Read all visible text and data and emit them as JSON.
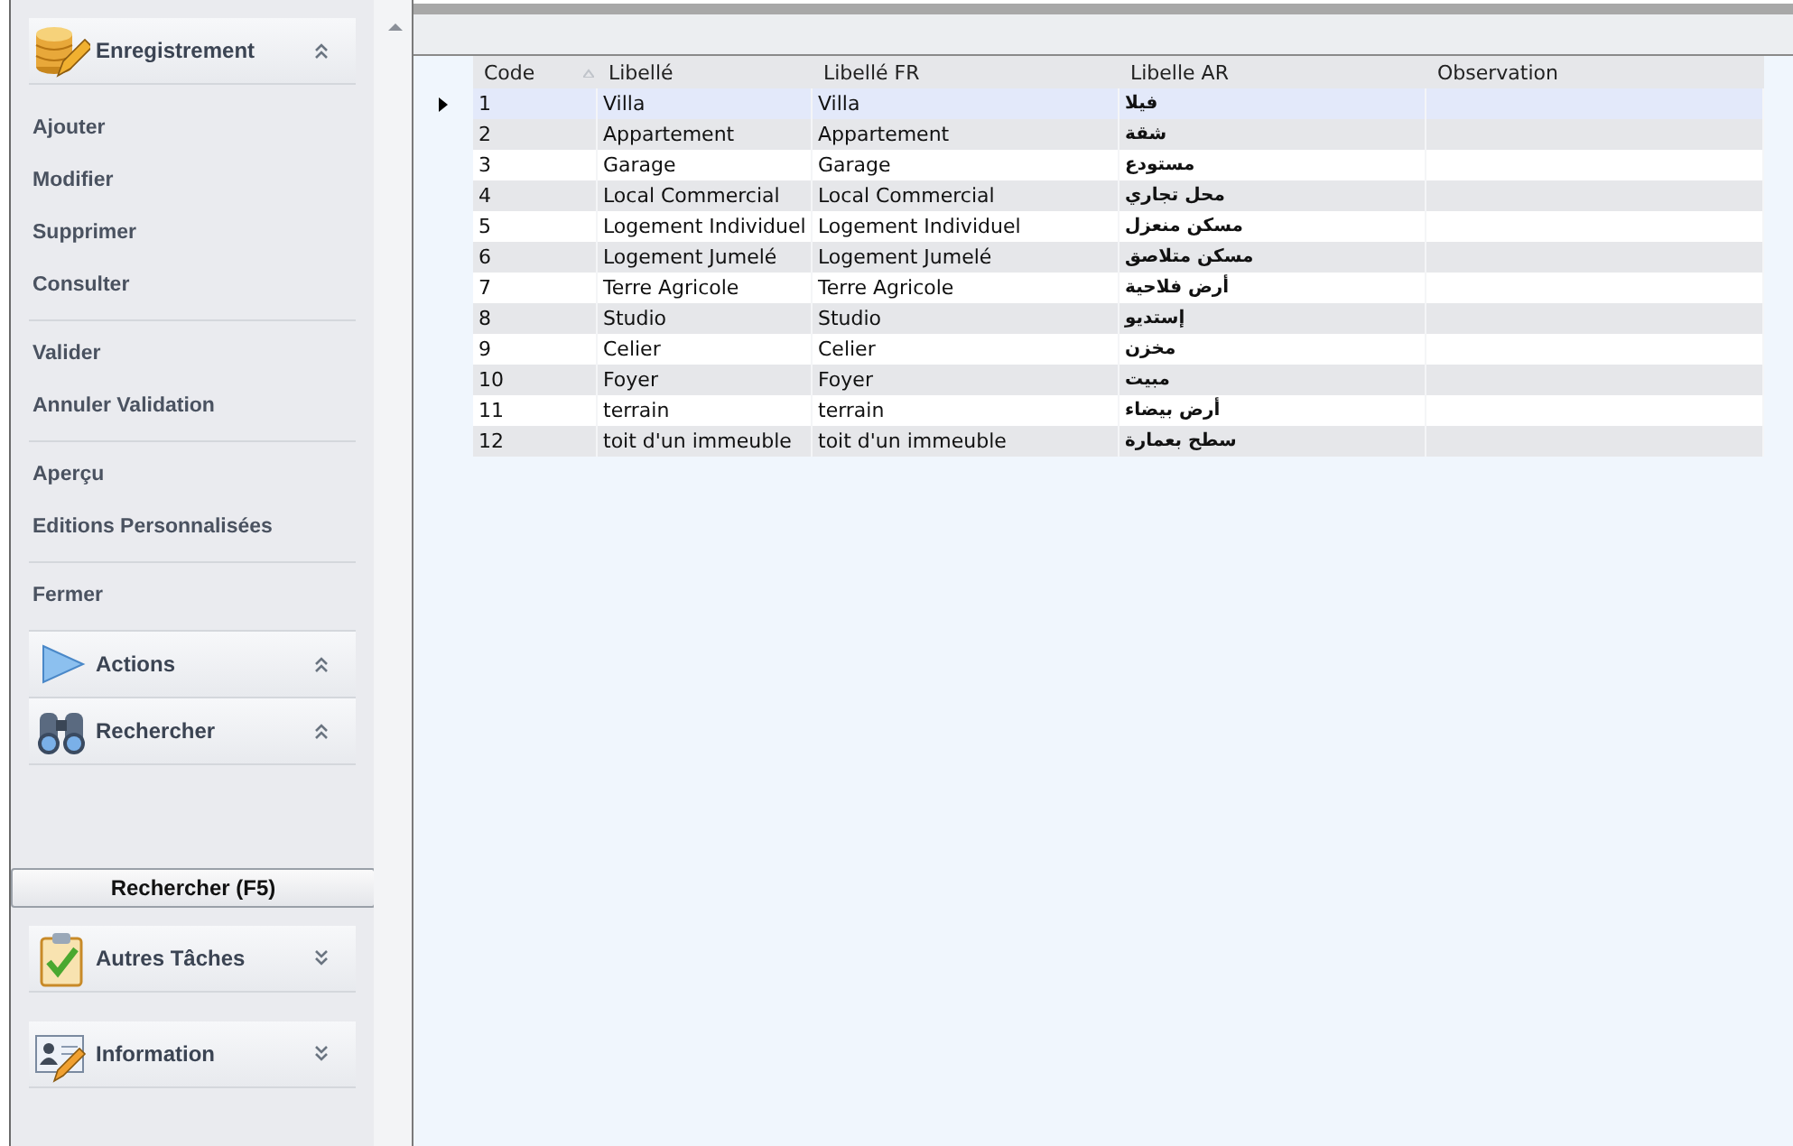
{
  "sidebar": {
    "groups": [
      {
        "title": "Enregistrement",
        "expanded": true,
        "item_groups": [
          [
            "Ajouter",
            "Modifier",
            "Supprimer",
            "Consulter"
          ],
          [
            "Valider",
            "Annuler Validation"
          ],
          [
            "Aperçu",
            "Editions Personnalisées"
          ],
          [
            "Fermer"
          ]
        ]
      },
      {
        "title": "Actions",
        "expanded": true
      },
      {
        "title": "Rechercher",
        "expanded": true,
        "button": "Rechercher (F5)"
      },
      {
        "title": "Autres Tâches",
        "expanded": false
      },
      {
        "title": "Information",
        "expanded": false
      }
    ]
  },
  "table": {
    "columns": [
      {
        "label": "Code",
        "sorted": true
      },
      {
        "label": "Libellé",
        "sorted": false
      },
      {
        "label": "Libellé FR",
        "sorted": false
      },
      {
        "label": "Libelle AR",
        "sorted": false
      },
      {
        "label": "Observation",
        "sorted": false
      }
    ],
    "rows": [
      {
        "selected": true,
        "cells": [
          "1",
          "Villa",
          "Villa",
          "فيلا"
        ]
      },
      {
        "selected": false,
        "cells": [
          "2",
          "Appartement",
          "Appartement",
          "شقة"
        ]
      },
      {
        "selected": false,
        "cells": [
          "3",
          "Garage",
          "Garage",
          "مستودع"
        ]
      },
      {
        "selected": false,
        "cells": [
          "4",
          "Local Commercial",
          "Local Commercial",
          "محل تجاري"
        ]
      },
      {
        "selected": false,
        "cells": [
          "5",
          "Logement Individuel",
          "Logement Individuel",
          "مسكن منعزل"
        ]
      },
      {
        "selected": false,
        "cells": [
          "6",
          "Logement Jumelé",
          "Logement Jumelé",
          "مسكن متلاصق"
        ]
      },
      {
        "selected": false,
        "cells": [
          "7",
          "Terre Agricole",
          "Terre Agricole",
          "أرض فلاحية"
        ]
      },
      {
        "selected": false,
        "cells": [
          "8",
          "Studio",
          "Studio",
          "إستديو"
        ]
      },
      {
        "selected": false,
        "cells": [
          "9",
          "Celier",
          "Celier",
          "مخزن"
        ]
      },
      {
        "selected": false,
        "cells": [
          "10",
          "Foyer",
          "Foyer",
          "مبيت"
        ]
      },
      {
        "selected": false,
        "cells": [
          "11",
          "terrain",
          "terrain",
          "أرض بيضاء"
        ]
      },
      {
        "selected": false,
        "cells": [
          "12",
          "toit d'un immeuble",
          "toit d'un immeuble",
          "سطح بعمارة"
        ]
      }
    ]
  }
}
